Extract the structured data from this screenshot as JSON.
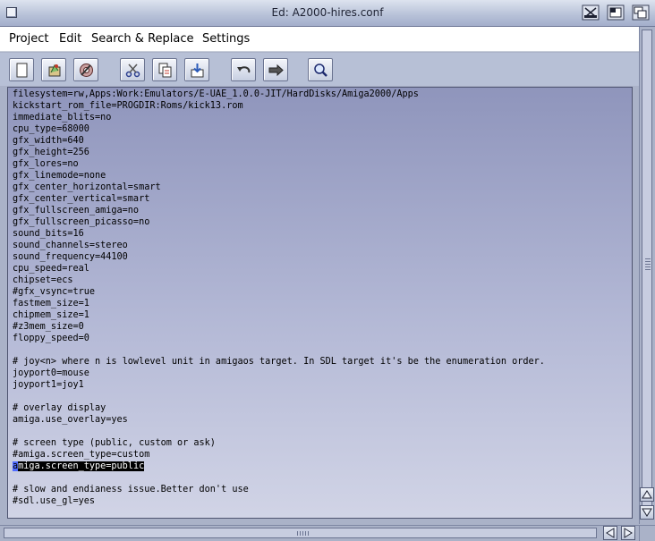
{
  "window": {
    "title": "Ed: A2000-hires.conf"
  },
  "menu": {
    "items": [
      "Project",
      "Edit",
      "Search & Replace",
      "Settings"
    ]
  },
  "toolbar": {
    "icons": [
      "new-icon",
      "open-icon",
      "save-icon",
      "cut-icon",
      "copy-icon",
      "paste-icon",
      "undo-icon",
      "redo-icon",
      "search-icon"
    ]
  },
  "editor": {
    "lines": [
      "filesystem=rw,Apps:Work:Emulators/E-UAE_1.0.0-JIT/HardDisks/Amiga2000/Apps",
      "kickstart_rom_file=PROGDIR:Roms/kick13.rom",
      "immediate_blits=no",
      "cpu_type=68000",
      "gfx_width=640",
      "gfx_height=256",
      "gfx_lores=no",
      "gfx_linemode=none",
      "gfx_center_horizontal=smart",
      "gfx_center_vertical=smart",
      "gfx_fullscreen_amiga=no",
      "gfx_fullscreen_picasso=no",
      "sound_bits=16",
      "sound_channels=stereo",
      "sound_frequency=44100",
      "cpu_speed=real",
      "chipset=ecs",
      "#gfx_vsync=true",
      "fastmem_size=1",
      "chipmem_size=1",
      "#z3mem_size=0",
      "floppy_speed=0",
      "",
      "# joy<n> where n is lowlevel unit in amigaos target. In SDL target it's be the enumeration order.",
      "joyport0=mouse",
      "joyport1=joy1",
      "",
      "# overlay display",
      "amiga.use_overlay=yes",
      "",
      "# screen type (public, custom or ask)",
      "#amiga.screen_type=custom",
      "amiga.screen_type=public",
      "",
      "# slow and endianess issue.Better don't use",
      "#sdl.use_gl=yes"
    ],
    "selected_line": 32,
    "cursor_char": "a",
    "selected_rest": "miga.screen_type=public"
  },
  "colors": {
    "editor_top": "#8f95bc",
    "editor_bottom": "#d1d4e6",
    "selection": "#000000",
    "cursor": "#4f6bff",
    "chrome": "#aab2c8"
  }
}
